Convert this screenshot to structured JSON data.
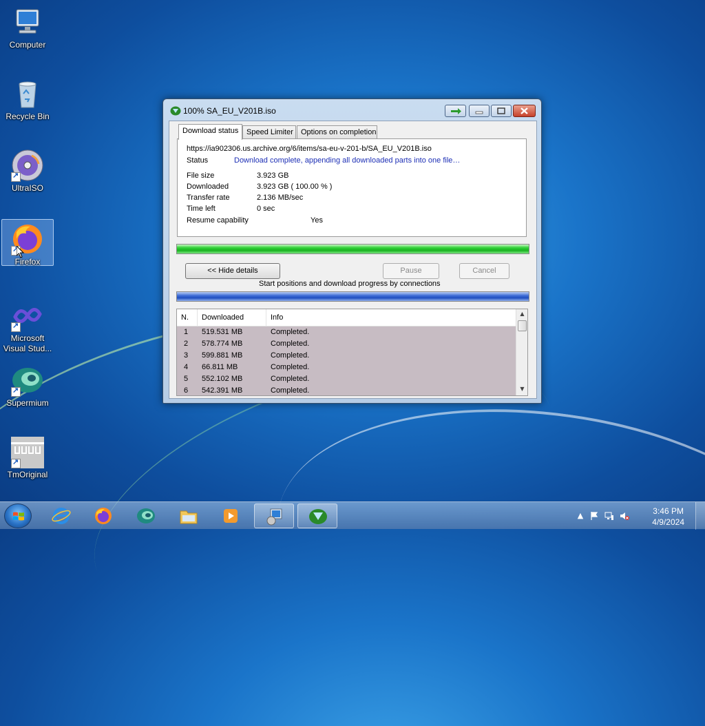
{
  "desktop": {
    "icons": [
      {
        "label": "Computer",
        "icon": "computer-icon"
      },
      {
        "label": "Recycle Bin",
        "icon": "recycle-bin-icon"
      },
      {
        "label": "UltraISO",
        "icon": "ultraiso-icon"
      },
      {
        "label": "Firefox",
        "icon": "firefox-icon"
      },
      {
        "label": "Microsoft Visual Stud...",
        "icon": "visual-studio-icon"
      },
      {
        "label": "Supermium",
        "icon": "supermium-icon"
      },
      {
        "label": "TmOriginal",
        "icon": "tmoriginal-icon"
      }
    ]
  },
  "window": {
    "title": "100% SA_EU_V201B.iso",
    "tabs": [
      "Download status",
      "Speed Limiter",
      "Options on completion"
    ],
    "url": "https://ia902306.us.archive.org/6/items/sa-eu-v-201-b/SA_EU_V201B.iso",
    "status_label": "Status",
    "status_value": "Download complete, appending all downloaded parts into one file…",
    "fields": {
      "file_size_label": "File size",
      "file_size_value": "3.923  GB",
      "downloaded_label": "Downloaded",
      "downloaded_value": "3.923  GB  ( 100.00 % )",
      "transfer_rate_label": "Transfer rate",
      "transfer_rate_value": "2.136  MB/sec",
      "time_left_label": "Time left",
      "time_left_value": "0 sec",
      "resume_label": "Resume capability",
      "resume_value": "Yes"
    },
    "progress_percent": 100,
    "buttons": {
      "hide_details": "<< Hide details",
      "pause": "Pause",
      "cancel": "Cancel"
    },
    "connections_caption": "Start positions and download progress by connections",
    "table": {
      "headers": [
        "N.",
        "Downloaded",
        "Info"
      ],
      "rows": [
        {
          "n": "1",
          "downloaded": "519.531  MB",
          "info": "Completed."
        },
        {
          "n": "2",
          "downloaded": "578.774  MB",
          "info": "Completed."
        },
        {
          "n": "3",
          "downloaded": "599.881  MB",
          "info": "Completed."
        },
        {
          "n": "4",
          "downloaded": "66.811  MB",
          "info": "Completed."
        },
        {
          "n": "5",
          "downloaded": "552.102  MB",
          "info": "Completed."
        },
        {
          "n": "6",
          "downloaded": "542.391  MB",
          "info": "Completed."
        }
      ]
    }
  },
  "taskbar": {
    "time": "3:46 PM",
    "date": "4/9/2024",
    "pinned": [
      "internet-explorer-icon",
      "firefox-icon",
      "supermium-icon",
      "file-explorer-icon",
      "media-player-icon",
      "control-panel-icon",
      "idm-icon"
    ]
  },
  "colors": {
    "status_text": "#1d2fb5",
    "progress_green": "#17b21f",
    "connection_blue": "#1f4fc0"
  }
}
